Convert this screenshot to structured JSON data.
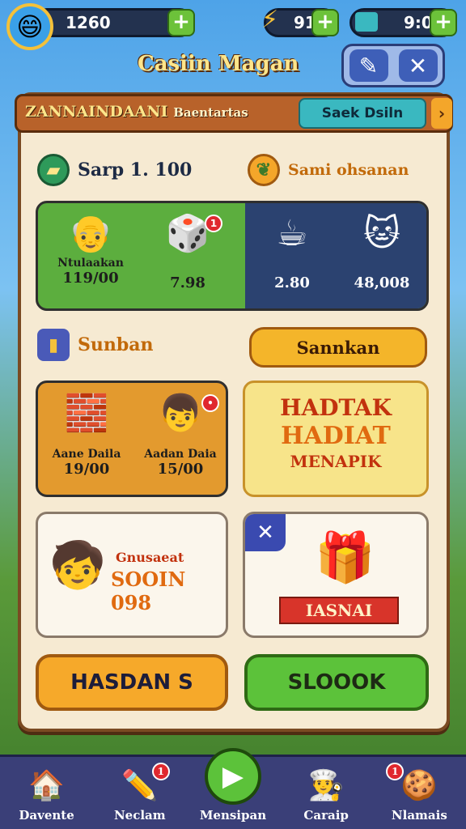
{
  "hud": {
    "coins": "1260",
    "energy": "91",
    "timer": "9:0",
    "plus": "+",
    "avatar_icon": "player-face-icon",
    "energy_icon": "lightning-icon",
    "timer_icon": "ticket-icon"
  },
  "header": {
    "title": "Casiin Magan",
    "close": "✕"
  },
  "tabs": {
    "tab1_main": "ZANNAINDAANI",
    "tab1_sub": "Baentartas",
    "tab2": "Saek Dsiln",
    "arrow": "›"
  },
  "stats": {
    "left": "Sarp 1. 100",
    "right": "Sami ohsanan"
  },
  "card1": {
    "items": [
      {
        "caption": "Ntulaakan",
        "value": "119/00",
        "icon": "grandpa-icon"
      },
      {
        "caption": "",
        "value": "7.98",
        "icon": "dice-box-icon",
        "badge": "1"
      },
      {
        "caption": "",
        "value": "2.80",
        "icon": "mug-icon"
      },
      {
        "caption": "",
        "value": "48,008",
        "icon": "cat-face-icon"
      }
    ]
  },
  "section": {
    "label": "Sunban",
    "button": "Sannkan"
  },
  "card2": {
    "items": [
      {
        "caption": "Aane Daila",
        "value": "19/00",
        "icon": "clay-block-icon"
      },
      {
        "caption": "Aadan Daia",
        "value": "15/00",
        "icon": "kid-face-icon",
        "badge": "•"
      }
    ]
  },
  "promo": {
    "line1": "HADTAK",
    "line2": "HADIAT",
    "line3": "MENAPIK"
  },
  "card3": {
    "caption": "Gnusaeat",
    "value": "SOOIN 098"
  },
  "card4": {
    "ribbon": "IASNAI",
    "close": "✕"
  },
  "buttons": {
    "left": "HASDAN S",
    "right": "SLOOOK"
  },
  "nav": [
    {
      "label": "Davente",
      "icon": "home-icon"
    },
    {
      "label": "Neclam",
      "icon": "pencil-icon",
      "badge": "1"
    },
    {
      "label": "Mensipan",
      "icon": "play-icon"
    },
    {
      "label": "Caraip",
      "icon": "chef-icon"
    },
    {
      "label": "Nlamais",
      "icon": "cookie-icon",
      "badge": "1"
    }
  ],
  "colors": {
    "panel": "#f6ead2",
    "green_card": "#5cae3e",
    "navy_card": "#2b4270",
    "orange_card": "#e39a2e",
    "yellow_button": "#f4b52a",
    "green_button": "#5cc23a",
    "nav_bg": "#3a3f78"
  }
}
